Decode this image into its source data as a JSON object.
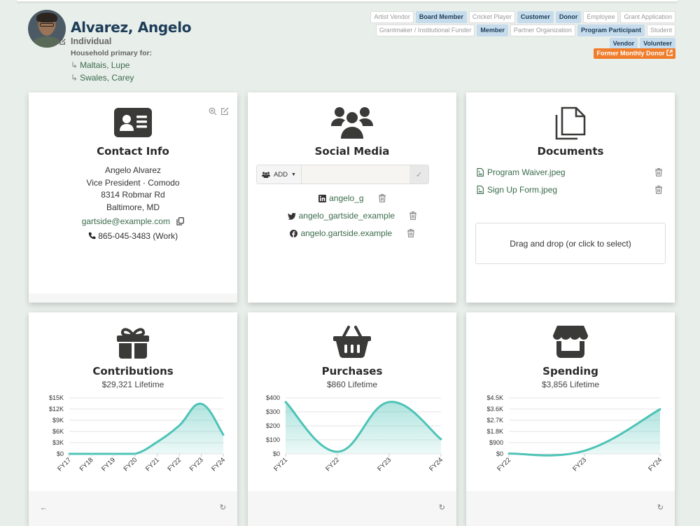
{
  "header": {
    "name": "Alvarez, Angelo",
    "contact_type": "Individual",
    "household_label": "Household primary for:",
    "household_members": [
      "Maltais, Lupe",
      "Swales, Carey"
    ],
    "tags": [
      {
        "label": "Artist Vendor",
        "active": false
      },
      {
        "label": "Board Member",
        "active": true
      },
      {
        "label": "Cricket Player",
        "active": false
      },
      {
        "label": "Customer",
        "active": true
      },
      {
        "label": "Donor",
        "active": true
      },
      {
        "label": "Employee",
        "active": false
      },
      {
        "label": "Grant Application",
        "active": false
      },
      {
        "label": "Grantmaker / Institutional Funder",
        "active": false
      },
      {
        "label": "Member",
        "active": true
      },
      {
        "label": "Partner Organization",
        "active": false
      },
      {
        "label": "Program Participant",
        "active": true
      },
      {
        "label": "Student",
        "active": false
      },
      {
        "label": "Vendor",
        "active": true
      },
      {
        "label": "Volunteer",
        "active": true
      }
    ],
    "special_tag": "Former Monthly Donor"
  },
  "contact_info": {
    "title": "Contact Info",
    "full_name": "Angelo Alvarez",
    "position": "Vice President · Comodo",
    "street": "8314 Robmar Rd",
    "city_state": "Baltimore, MD",
    "email": "gartside@example.com",
    "phone": "865-045-3483 (Work)"
  },
  "social_media": {
    "title": "Social Media",
    "add_label": "ADD",
    "input_value": "",
    "accounts": [
      {
        "network": "linkedin",
        "handle": "angelo_g"
      },
      {
        "network": "twitter",
        "handle": "angelo_gartside_example"
      },
      {
        "network": "facebook",
        "handle": "angelo.gartside.example"
      }
    ]
  },
  "documents": {
    "title": "Documents",
    "files": [
      "Program Waiver.jpeg",
      "Sign Up Form.jpeg"
    ],
    "dropzone_label": "Drag and drop (or click to select)"
  },
  "colors": {
    "accent_line": "#4ec3b7",
    "link": "#3b6b4b",
    "name": "#1d3d58",
    "active_tag": "#c6dcec",
    "special_tag": "#f07d2c"
  },
  "chart_data": [
    {
      "type": "area",
      "title": "Contributions",
      "subtitle": "$29,321 Lifetime",
      "categories": [
        "FY17",
        "FY18",
        "FY19",
        "FY20",
        "FY21",
        "FY22",
        "FY23",
        "FY24"
      ],
      "values": [
        0,
        0,
        0,
        0,
        3200,
        7600,
        13400,
        5121
      ],
      "ylim": [
        0,
        15000
      ],
      "yticks": [
        0,
        3000,
        6000,
        9000,
        12000,
        15000
      ],
      "ytick_labels": [
        "$0",
        "$3K",
        "$6K",
        "$9K",
        "$12K",
        "$15K"
      ],
      "grid": true
    },
    {
      "type": "area",
      "title": "Purchases",
      "subtitle": "$860 Lifetime",
      "categories": [
        "FY21",
        "FY22",
        "FY23",
        "FY24"
      ],
      "values": [
        370,
        15,
        370,
        105
      ],
      "ylim": [
        0,
        400
      ],
      "yticks": [
        0,
        100,
        200,
        300,
        400
      ],
      "ytick_labels": [
        "$0",
        "$100",
        "$200",
        "$300",
        "$400"
      ],
      "grid": true
    },
    {
      "type": "area",
      "title": "Spending",
      "subtitle": "$3,856 Lifetime",
      "categories": [
        "FY22",
        "FY23",
        "FY24"
      ],
      "values": [
        20,
        250,
        3586
      ],
      "ylim": [
        0,
        4500
      ],
      "yticks": [
        0,
        900,
        1800,
        2700,
        3600,
        4500
      ],
      "ytick_labels": [
        "$0",
        "$900",
        "$1.8K",
        "$2.7K",
        "$3.6K",
        "$4.5K"
      ],
      "grid": true
    }
  ]
}
